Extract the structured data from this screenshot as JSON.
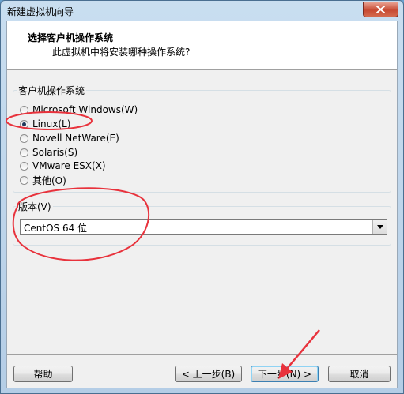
{
  "window": {
    "title": "新建虚拟机向导"
  },
  "header": {
    "title": "选择客户机操作系统",
    "subtitle": "此虚拟机中将安装哪种操作系统?"
  },
  "os_group": {
    "label": "客户机操作系统",
    "options": [
      {
        "label": "Microsoft Windows(W)",
        "selected": false
      },
      {
        "label": "Linux(L)",
        "selected": true
      },
      {
        "label": "Novell NetWare(E)",
        "selected": false
      },
      {
        "label": "Solaris(S)",
        "selected": false
      },
      {
        "label": "VMware ESX(X)",
        "selected": false
      },
      {
        "label": "其他(O)",
        "selected": false
      }
    ]
  },
  "version_group": {
    "label": "版本(V)",
    "selected_value": "CentOS 64 位"
  },
  "buttons": {
    "help": "帮助",
    "back": "< 上一步(B)",
    "next": "下一步(N) >",
    "cancel": "取消"
  },
  "colors": {
    "annotation_red": "#e8323c",
    "selected_radio_dot": "#1e395b",
    "default_button_border": "#3c7fb1"
  },
  "icons": {
    "close": "close-x-icon",
    "dropdown": "chevron-down-icon"
  }
}
